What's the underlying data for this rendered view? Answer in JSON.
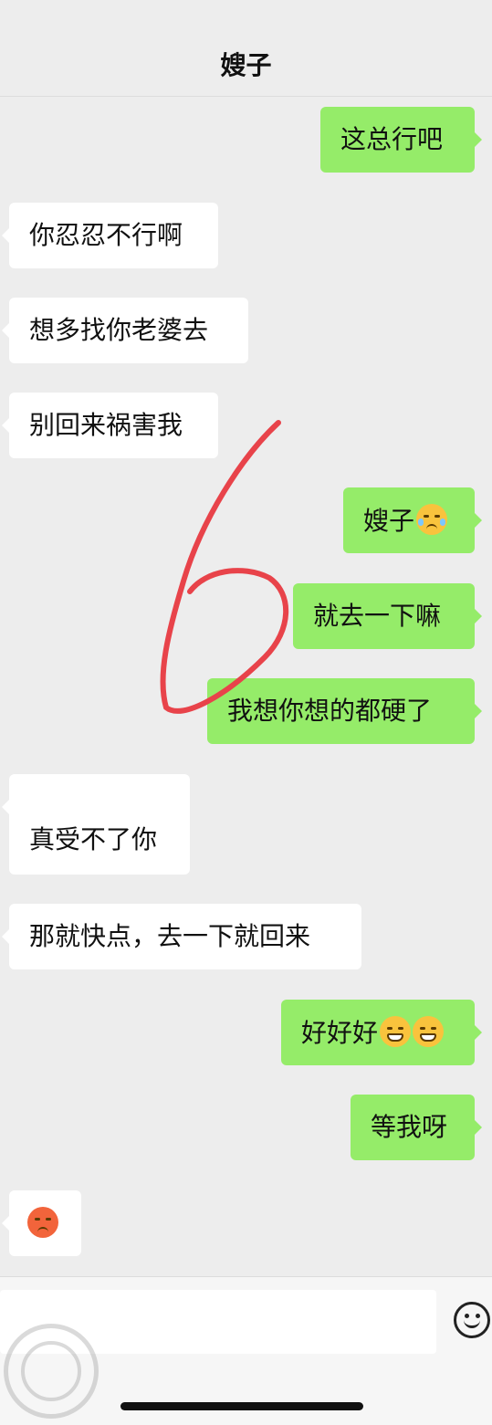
{
  "header": {
    "title": "嫂子"
  },
  "messages": [
    {
      "side": "right",
      "text": "这总行吧"
    },
    {
      "side": "left",
      "text": "你忍忍不行啊"
    },
    {
      "side": "left",
      "text": "想多找你老婆去"
    },
    {
      "side": "left",
      "text": "别回来祸害我"
    },
    {
      "side": "right",
      "text": "嫂子"
    },
    {
      "side": "right",
      "text": "就去一下嘛"
    },
    {
      "side": "right",
      "text": "我想你想的都硬了"
    },
    {
      "side": "left",
      "text": "真受不了你"
    },
    {
      "side": "left",
      "text": "那就快点，去一下就回来"
    },
    {
      "side": "right",
      "text": "好好好"
    },
    {
      "side": "right",
      "text": "等我呀"
    },
    {
      "side": "left",
      "text": ""
    }
  ],
  "emoji_names": [
    "crying-laughing-emoji",
    "grin-emoji",
    "red-hot-face-emoji"
  ],
  "annotation": "6",
  "input": {
    "placeholder": ""
  },
  "colors": {
    "sent": "#95ec69",
    "received": "#ffffff",
    "background": "#ededed",
    "annotation": "#e8434a"
  }
}
